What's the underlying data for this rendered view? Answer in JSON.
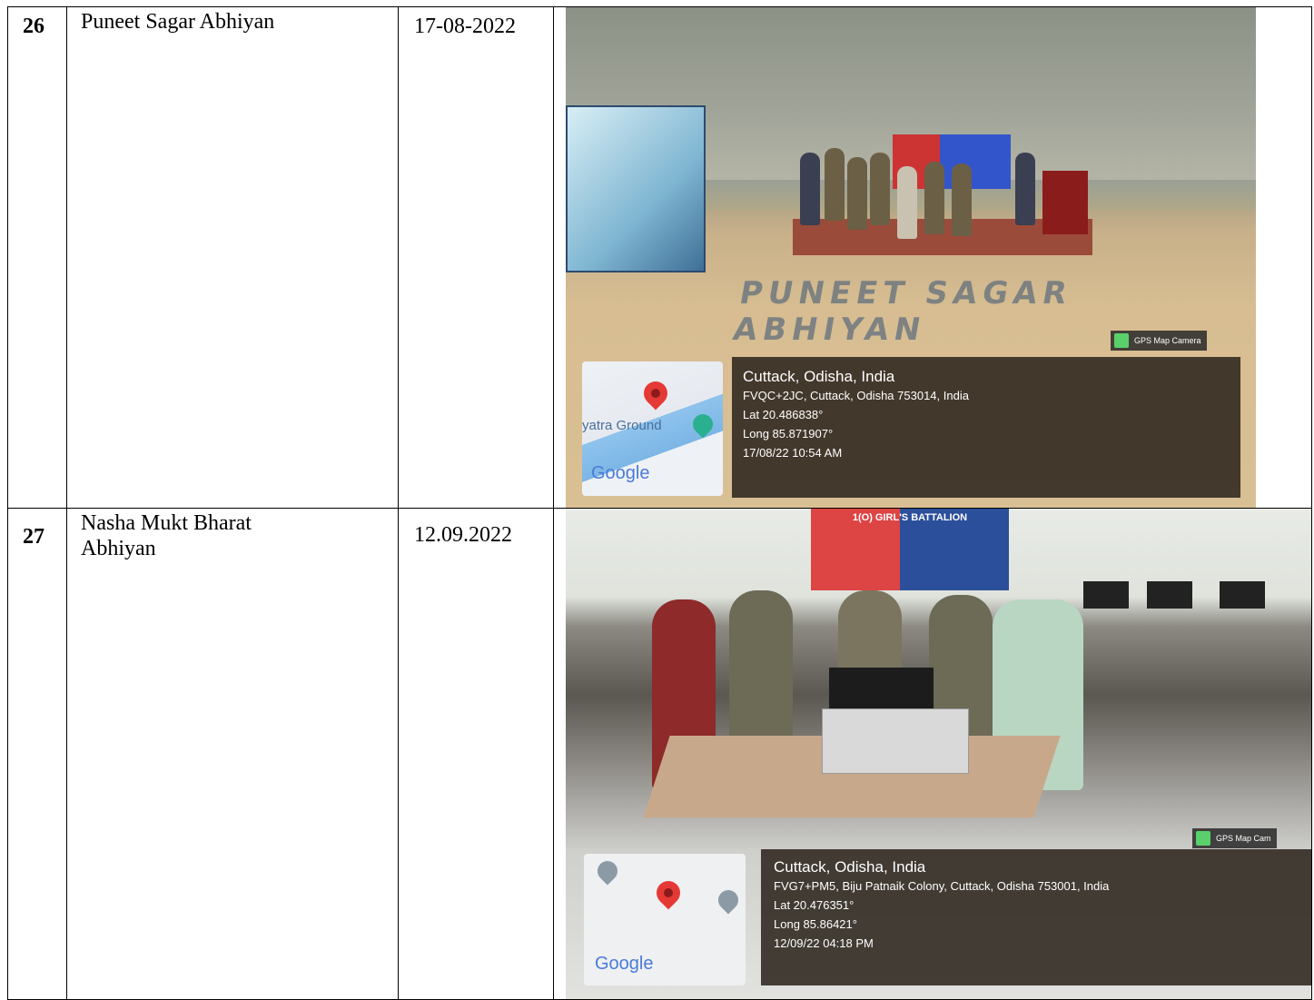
{
  "rows": [
    {
      "sno": "26",
      "event": "Puneet Sagar Abhiyan",
      "date": "17-08-2022",
      "photo": {
        "sand_text": "PUNEET SAGAR ABHIYAN",
        "badge": "GPS Map Camera",
        "map_label": "yatra Ground",
        "map_brand": "Google",
        "location_title": "Cuttack, Odisha, India",
        "address": "FVQC+2JC, Cuttack, Odisha 753014, India",
        "lat": "Lat 20.486838°",
        "long": "Long 85.871907°",
        "timestamp": "17/08/22 10:54 AM"
      }
    },
    {
      "sno": "27",
      "event": "Nasha Mukt Bharat Abhiyan",
      "date": "12.09.2022",
      "photo": {
        "banner_text": "1(O) GIRL'S BATTALION",
        "badge": "GPS Map Cam",
        "map_brand": "Google",
        "location_title": "Cuttack, Odisha, India",
        "address": "FVG7+PM5, Biju Patnaik Colony, Cuttack, Odisha 753001, India",
        "lat": "Lat 20.476351°",
        "long": "Long 85.86421°",
        "timestamp": "12/09/22 04:18 PM"
      }
    }
  ]
}
